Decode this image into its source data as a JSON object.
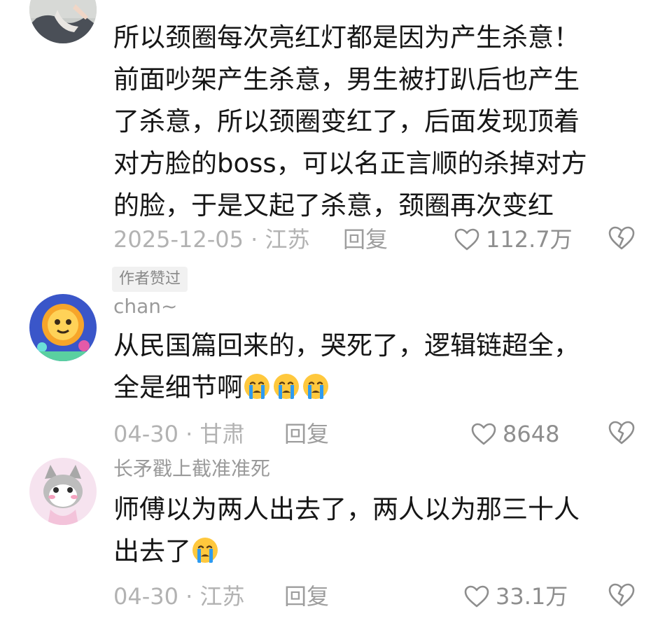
{
  "comments": [
    {
      "username": "",
      "text_lines": [
        "所以颈圈每次亮红灯都是因为产生杀意！",
        "前面吵架产生杀意，男生被打趴后也产生",
        "了杀意，所以颈圈变红了，后面发现顶着",
        "对方脸的boss，可以名正言顺的杀掉对方",
        "的脸，于是又起了杀意，颈圈再次变红"
      ],
      "date_location": "2025-12-05 · 江苏",
      "reply_label": "回复",
      "like_count": "112.7万",
      "author_liked_badge": "作者赞过"
    },
    {
      "username": "chan~",
      "text_lines": [
        "从民国篇回来的，哭死了，逻辑链超全，",
        "全是细节啊"
      ],
      "emoji_count": 3,
      "date_location": "04-30 · 甘肃",
      "reply_label": "回复",
      "like_count": "8648"
    },
    {
      "username": "长矛戳上截准准死",
      "text_lines": [
        "师傅以为两人出去了，两人以为那三十人",
        "出去了"
      ],
      "emoji_count": 1,
      "date_location": "04-30 · 江苏",
      "reply_label": "回复",
      "like_count": "33.1万"
    }
  ],
  "icons": {
    "like": "heart-outline-icon",
    "dislike": "broken-heart-icon",
    "emoji": "loudly-crying-face-emoji"
  },
  "colors": {
    "text": "#161616",
    "meta": "#b2b2b2",
    "badge_bg": "#f1f1f1",
    "emoji_face": "#ffc83d",
    "emoji_tears": "#2e9bf0"
  }
}
